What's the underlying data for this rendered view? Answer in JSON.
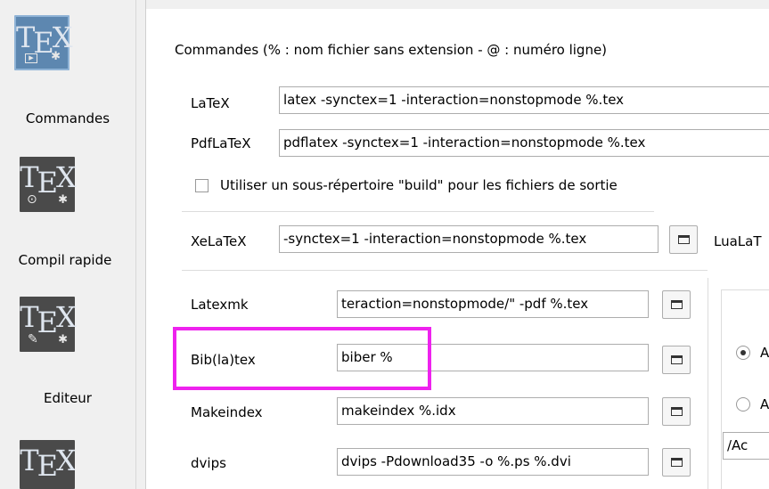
{
  "top_stub": "%.",
  "sidebar": {
    "items": [
      {
        "label": "Commandes",
        "icon": "tex-commands-icon",
        "selected": true
      },
      {
        "label": "Compil rapide",
        "icon": "tex-quick-build-icon",
        "selected": false
      },
      {
        "label": "Editeur",
        "icon": "tex-editor-icon",
        "selected": false
      },
      {
        "label": "",
        "icon": "tex-icon",
        "selected": false
      }
    ],
    "tex_glyph_t": "T",
    "tex_glyph_e": "E",
    "tex_glyph_x": "X"
  },
  "header": {
    "title": "Commandes (% : nom fichier sans extension - @ : numéro ligne)"
  },
  "commands": {
    "latex": {
      "label": "LaTeX",
      "value": "latex  -synctex=1 -interaction=nonstopmode %.tex"
    },
    "pdflatex": {
      "label": "PdfLaTeX",
      "value": "pdflatex -synctex=1 -interaction=nonstopmode %.tex"
    },
    "build_subdir": {
      "label": "Utiliser un sous-répertoire \"build\" pour les fichiers de sortie",
      "checked": false
    },
    "xelatex": {
      "label": "XeLaTeX",
      "value": "-synctex=1 -interaction=nonstopmode %.tex"
    },
    "lualatex": {
      "label": "LuaLaT"
    },
    "latexmk": {
      "label": "Latexmk",
      "value": "teraction=nonstopmode/\" -pdf %.tex"
    },
    "biblatex": {
      "label": "Bib(la)tex",
      "value": "biber %"
    },
    "makeindex": {
      "label": "Makeindex",
      "value": "makeindex %.idx"
    },
    "dvips": {
      "label": "dvips",
      "value": "dvips -Pdownload35 -o %.ps %.dvi"
    }
  },
  "right_group": {
    "radio1_label": "A",
    "radio2_label": "A",
    "path_value": "/Ac"
  },
  "colors": {
    "highlight": "#ee22ee",
    "selected_icon_bg": "#5d87b0"
  }
}
